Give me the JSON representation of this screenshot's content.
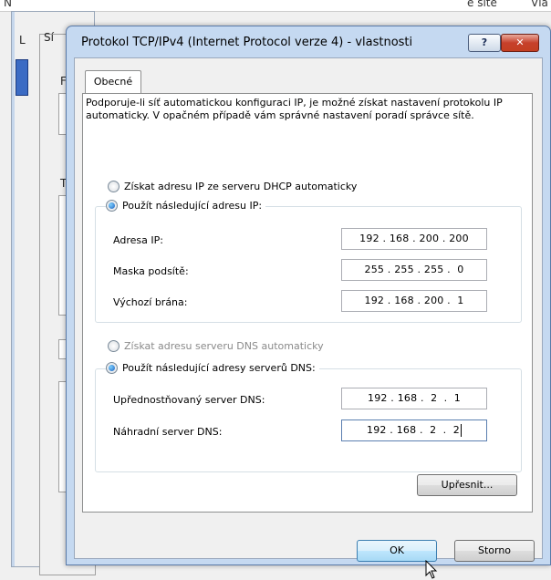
{
  "background": {
    "top_fragments": [
      "N",
      "e site",
      "Vla"
    ],
    "left_letters": [
      "L",
      "Sí",
      "F",
      "T"
    ]
  },
  "dialog": {
    "title": "Protokol TCP/IPv4 (Internet Protocol verze 4) - vlastnosti",
    "help_label": "?",
    "close_label": "✕",
    "tab_label": "Obecné",
    "intro": "Podporuje-li síť automatickou konfiguraci IP, je možné získat nastavení protokolu IP automaticky. V opačném případě vám správné nastavení poradí správce sítě.",
    "ip_auto_label": "Získat adresu IP ze serveru DHCP automaticky",
    "ip_manual_label": "Použít následující adresu IP:",
    "ip_address_label": "Adresa IP:",
    "ip_address_value": "192 . 168 . 200 . 200",
    "subnet_label": "Maska podsítě:",
    "subnet_value": "255 . 255 . 255 .  0",
    "gateway_label": "Výchozí brána:",
    "gateway_value": "192 . 168 . 200 .  1",
    "dns_auto_label": "Získat adresu serveru DNS automaticky",
    "dns_manual_label": "Použít následující adresy serverů DNS:",
    "dns_pref_label": "Upřednostňovaný server DNS:",
    "dns_pref_value": "192 . 168 .  2  .  1",
    "dns_alt_label": "Náhradní server DNS:",
    "dns_alt_value": "192 . 168 .  2  .  2",
    "advanced_label": "Upřesnit...",
    "ok_label": "OK",
    "cancel_label": "Storno"
  },
  "icons": [
    "help-icon",
    "close-icon",
    "mouse-cursor-icon",
    "network-icon"
  ],
  "colors": {
    "titlebar": "#c5d9f1",
    "close_button": "#c43f22",
    "default_button": "#3c7fb1",
    "radio_selected": "#1a5fbf"
  }
}
